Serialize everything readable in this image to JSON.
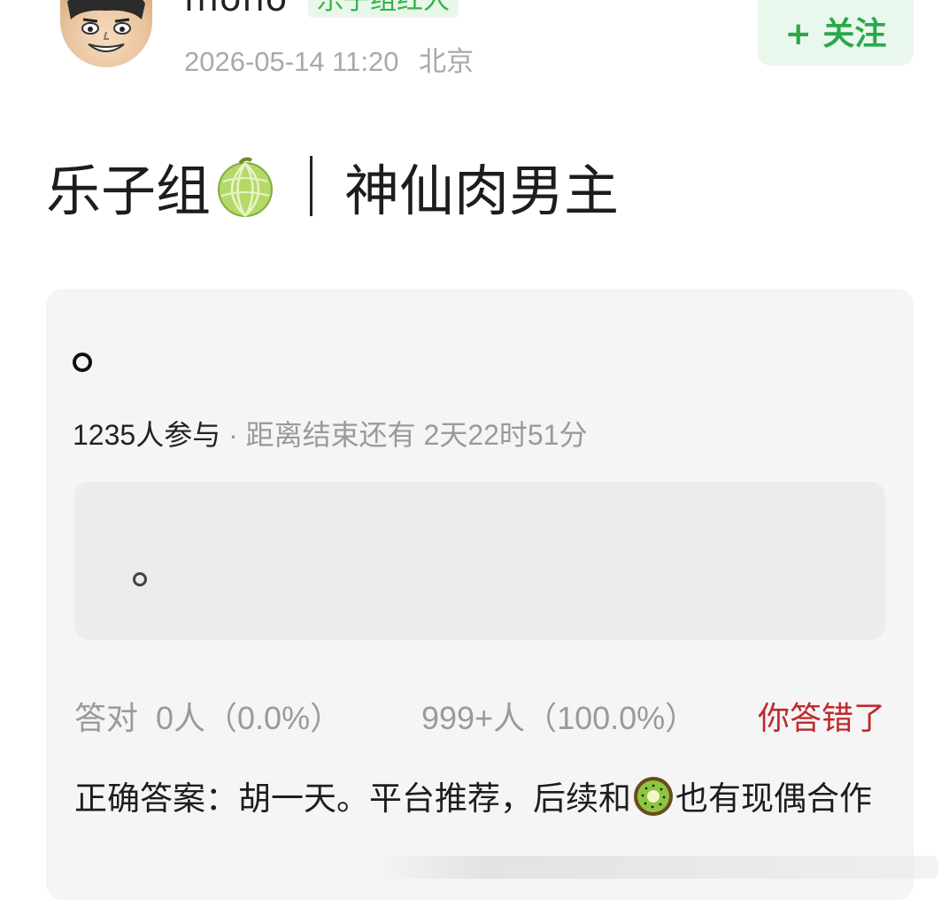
{
  "header": {
    "username": "mono",
    "user_badge": "乐子组红人",
    "timestamp": "2026-05-14 11:20",
    "location": "北京",
    "follow_label": "+ 关注"
  },
  "post": {
    "group_name": "乐子组",
    "group_emoji": "melon-emoji",
    "topic": "神仙肉男主"
  },
  "quiz": {
    "question_text": "。",
    "participants": "1235人参与",
    "separator": "·",
    "countdown": "距离结束还有 2天22时51分",
    "option_text": "。",
    "correct_stat": "答对  0人（0.0%）",
    "wrong_stat": "999+人（100.0%）",
    "result_label": "你答错了",
    "answer_prefix": "正确答案：胡一天。平台推荐，后续和",
    "answer_emoji": "kiwi-emoji",
    "answer_suffix": "也有现偶合作"
  },
  "colors": {
    "accent_green": "#2aa84a",
    "wrong_red": "#c0282b",
    "muted_text": "#9a9a9a"
  }
}
